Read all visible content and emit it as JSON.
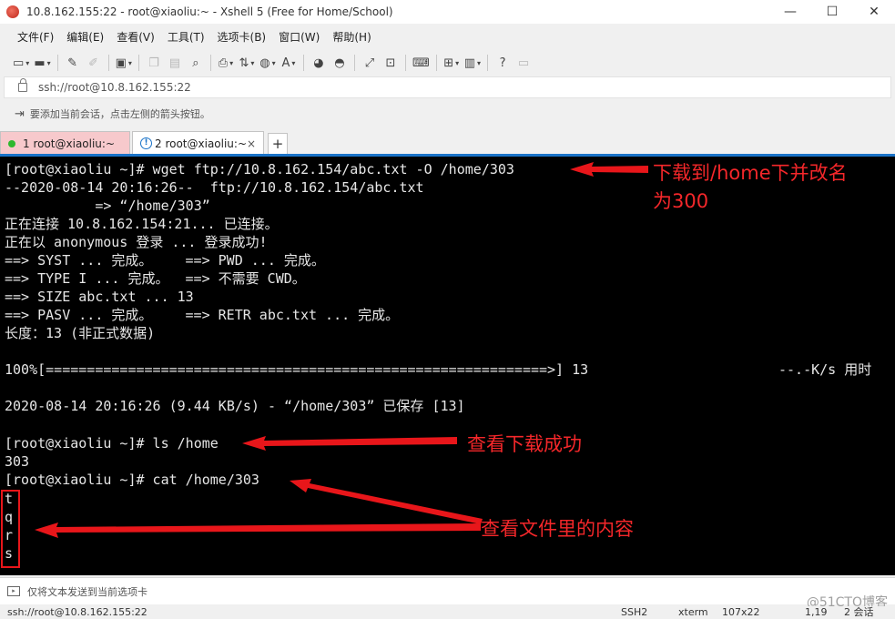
{
  "window": {
    "title": "10.8.162.155:22 - root@xiaoliu:~ - Xshell 5 (Free for Home/School)",
    "minimize": "—",
    "maximize": "☐",
    "close": "✕"
  },
  "menu": [
    "文件(F)",
    "编辑(E)",
    "查看(V)",
    "工具(T)",
    "选项卡(B)",
    "窗口(W)",
    "帮助(H)"
  ],
  "address": {
    "text": "ssh://root@10.8.162.155:22"
  },
  "hint": {
    "text": "要添加当前会话，点击左侧的箭头按钮。"
  },
  "tabs": [
    {
      "label": "1 root@xiaoliu:~"
    },
    {
      "label": "2 root@xiaoliu:~",
      "close": "×"
    }
  ],
  "tab_add": "+",
  "terminal": {
    "lines": [
      "[root@xiaoliu ~]# wget ftp://10.8.162.154/abc.txt -O /home/303",
      "--2020-08-14 20:16:26--  ftp://10.8.162.154/abc.txt",
      "           => “/home/303”",
      "正在连接 10.8.162.154:21... 已连接。",
      "正在以 anonymous 登录 ... 登录成功!",
      "==> SYST ... 完成。    ==> PWD ... 完成。",
      "==> TYPE I ... 完成。  ==> 不需要 CWD。",
      "==> SIZE abc.txt ... 13",
      "==> PASV ... 完成。    ==> RETR abc.txt ... 完成。",
      "长度：13 (非正式数据)",
      "",
      "100%[=============================================================>] 13",
      "",
      "2020-08-14 20:16:26 (9.44 KB/s) - “/home/303” 已保存 [13]",
      "",
      "[root@xiaoliu ~]# ls /home",
      "303",
      "[root@xiaoliu ~]# cat /home/303",
      "t",
      "q",
      "r",
      "s"
    ],
    "progress_tail": "--.-K/s 用时"
  },
  "annotations": {
    "download_note_1": "下载到/home下并改名",
    "download_note_2": "为300",
    "ls_note": "查看下载成功",
    "cat_note": "查看文件里的内容",
    "color": "#f4272a"
  },
  "sendbar": {
    "text": "仅将文本发送到当前选项卡"
  },
  "statusbar": {
    "connection": "ssh://root@10.8.162.155:22",
    "protocol": "SSH2",
    "terminal_type": "xterm",
    "size": "107x22",
    "cursor": "1,19",
    "sessions": "2 会话"
  },
  "watermark": "@51CTO博客"
}
